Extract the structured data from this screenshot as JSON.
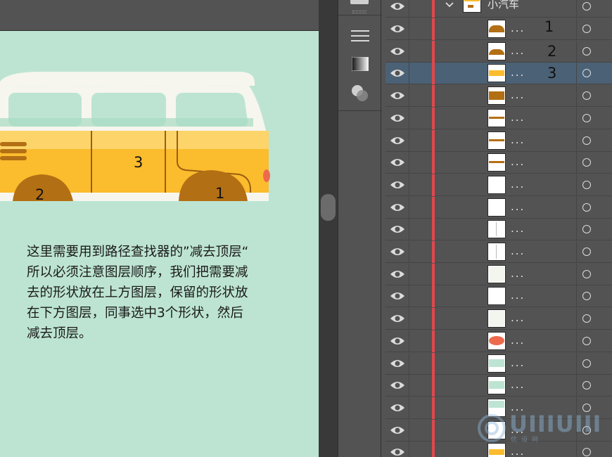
{
  "canvas": {
    "labels": {
      "part_1": "1",
      "part_2": "2",
      "part_3": "3"
    },
    "note": "这里需要用到路径查找器的”减去顶层“\n所以必须注意图层顺序，我们把需要减\n去的形状放在上方图层，保留的形状放\n在下方图层，同事选中3个形状，然后\n减去顶层。"
  },
  "colors": {
    "artboard_bg": "#bde4d2",
    "bus_body": "#fbbc2d",
    "bus_roof": "#f6f6ee",
    "bus_window": "#bde4d2",
    "wheel_arch": "#b36f14",
    "tail_light": "#ee6a4c",
    "layer_red": "#e0474c",
    "selected_row": "#4b6176"
  },
  "tools": [
    {
      "icon": "align-lines-icon"
    },
    {
      "icon": "gradient-icon"
    },
    {
      "icon": "transparency-icon"
    }
  ],
  "layers": {
    "group": {
      "name": "小汽车",
      "expanded": true
    },
    "items": [
      {
        "name": "...",
        "thumb": "arch",
        "thumb_color": "#b36f14",
        "annot": "1"
      },
      {
        "name": "...",
        "thumb": "arch-low",
        "thumb_color": "#b36f14",
        "annot": "2"
      },
      {
        "name": "...",
        "thumb": "band",
        "thumb_color": "#fbbc2d",
        "annot": "3",
        "selected": true
      },
      {
        "name": "...",
        "thumb": "band-thick",
        "thumb_color": "#b36f14"
      },
      {
        "name": "...",
        "thumb": "line",
        "thumb_color": "#b36f14"
      },
      {
        "name": "...",
        "thumb": "line",
        "thumb_color": "#b36f14"
      },
      {
        "name": "...",
        "thumb": "line",
        "thumb_color": "#b36f14"
      },
      {
        "name": "...",
        "thumb": "blank",
        "thumb_color": "#ffffff"
      },
      {
        "name": "...",
        "thumb": "blank",
        "thumb_color": "#ffffff"
      },
      {
        "name": "...",
        "thumb": "vline",
        "thumb_color": "#dddddd"
      },
      {
        "name": "...",
        "thumb": "vline",
        "thumb_color": "#dddddd"
      },
      {
        "name": "...",
        "thumb": "pale",
        "thumb_color": "#f3f6ee"
      },
      {
        "name": "...",
        "thumb": "blank",
        "thumb_color": "#ffffff"
      },
      {
        "name": "...",
        "thumb": "pale",
        "thumb_color": "#f3f6ee"
      },
      {
        "name": "...",
        "thumb": "oval",
        "thumb_color": "#ee6a4c"
      },
      {
        "name": "...",
        "thumb": "mint",
        "thumb_color": "#bde4d2"
      },
      {
        "name": "...",
        "thumb": "mint",
        "thumb_color": "#bde4d2"
      },
      {
        "name": "...",
        "thumb": "mint-top",
        "thumb_color": "#bde4d2"
      },
      {
        "name": "...",
        "thumb": "blank",
        "thumb_color": "#ffffff"
      },
      {
        "name": "...",
        "thumb": "band",
        "thumb_color": "#fbbc2d"
      }
    ]
  },
  "watermark": {
    "text": "UIIIUIII",
    "sub": "优设网"
  }
}
